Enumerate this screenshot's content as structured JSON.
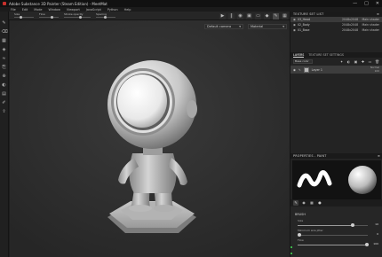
{
  "window": {
    "title": "Adobe Substance 3D Painter (Steam Edition) - MeetMat",
    "controls": [
      "—",
      "□",
      "✕"
    ]
  },
  "menu": [
    "File",
    "Edit",
    "Mode",
    "Window",
    "Viewport",
    "JavaScript",
    "Python",
    "Help"
  ],
  "toolbar": {
    "size_label": "Size",
    "flow_label": "Flow",
    "stroke_opacity_label": "Stroke opacity",
    "spacing_label": "Spacing",
    "size_value": 0.25,
    "flow_value": 0.6,
    "stroke_opacity_value": 0.55,
    "spacing_value": 0.4
  },
  "viewport": {
    "camera_dropdown": "Default camera",
    "material_dropdown": "Material",
    "buttons": [
      "play-icon",
      "pause-icon",
      "camera-icon",
      "screenshot-icon",
      "frame-icon",
      "cube-icon",
      "pen-icon",
      "grid-icon"
    ]
  },
  "texture_set_list": {
    "title": "TEXTURE SET LIST",
    "items": [
      {
        "name": "03_Head",
        "resolution": "2048x2048",
        "shader": "Main shader",
        "selected": true
      },
      {
        "name": "02_Body",
        "resolution": "2048x2048",
        "shader": "Main shader",
        "selected": false
      },
      {
        "name": "01_Base",
        "resolution": "2048x2048",
        "shader": "Main shader",
        "selected": false
      }
    ]
  },
  "layers": {
    "tab_layers": "LAYERS",
    "tab_settings": "TEXTURE SET SETTINGS",
    "channel_dropdown": "Base color",
    "rows": [
      {
        "name": "Layer 1",
        "blend": "Normal",
        "opacity": "100"
      }
    ]
  },
  "properties": {
    "title": "PROPERTIES - PAINT",
    "section": "BRUSH",
    "size_label": "Size",
    "size_value": "10",
    "size_fraction": 0.78,
    "min_size_label": "Minimum size jitter",
    "min_size_value": "0",
    "min_size_fraction": 0.0,
    "flow_section": "Flow",
    "flow_value": "100",
    "flow_fraction": 1.0
  },
  "colors": {
    "accent_green": "#3db54a",
    "panel_bg": "#232323",
    "viewport_bg": "#2f2f2f"
  }
}
